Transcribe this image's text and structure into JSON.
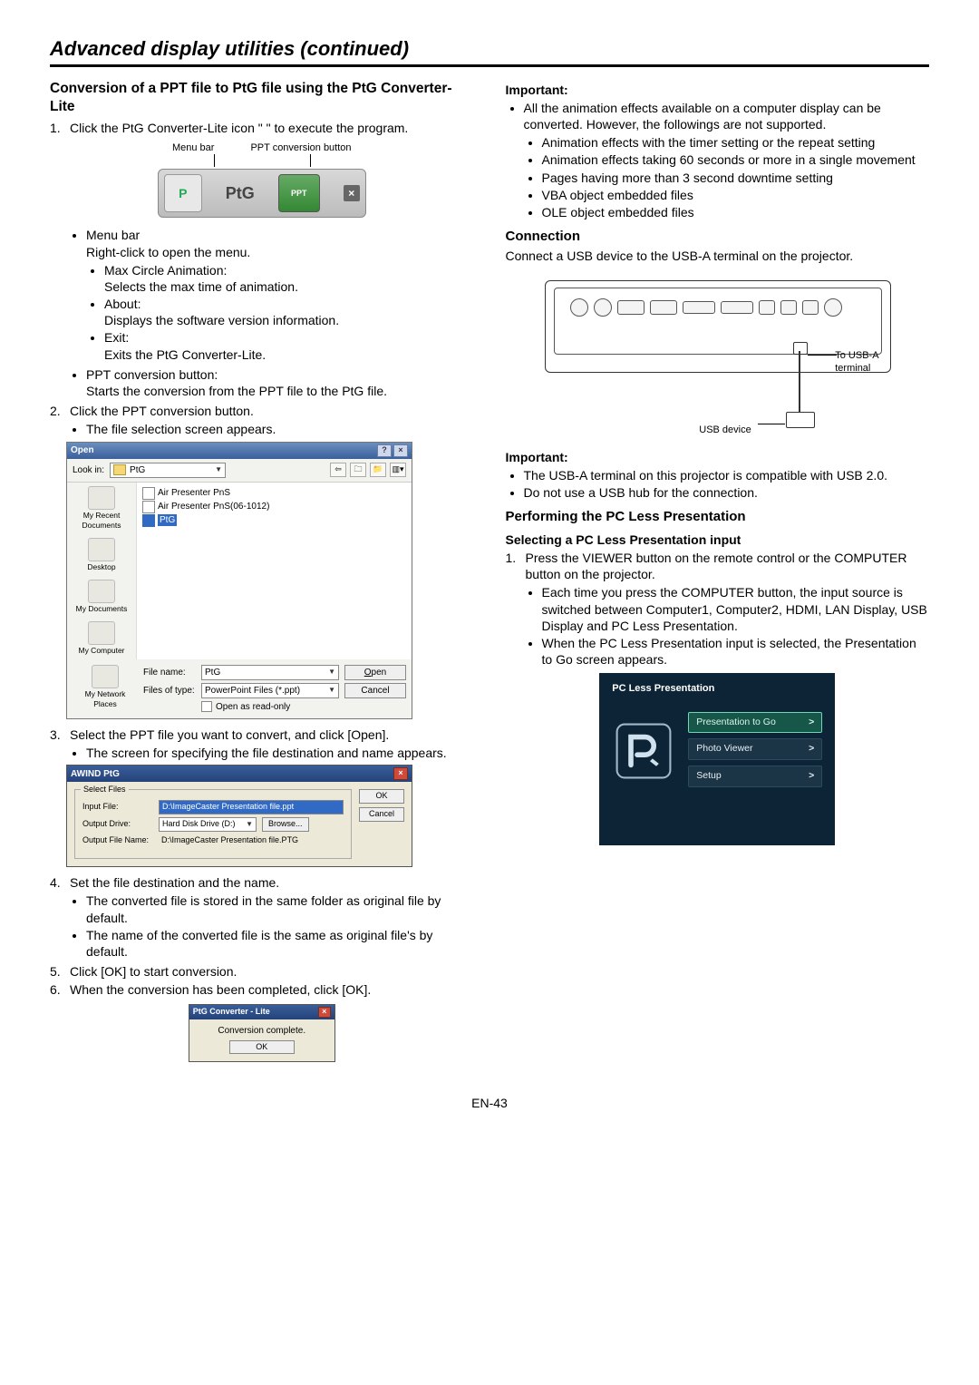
{
  "page": {
    "title": "Advanced display utilities (continued)",
    "footer": "EN-43"
  },
  "left": {
    "h2": "Conversion of a PPT file to PtG file using the PtG Converter-Lite",
    "step1": "Click the PtG Converter-Lite icon \"     \" to execute the program.",
    "labels": {
      "menubar": "Menu bar",
      "pptbtn": "PPT conversion button"
    },
    "ptg_text": "PtG",
    "ppt_btn": "PPT",
    "menu": {
      "menubar": "Menu bar",
      "menubar_sub": "Right-click to open the menu.",
      "max": "Max Circle Animation:",
      "max_sub": "Selects the max time of animation.",
      "about": "About:",
      "about_sub": "Displays the software version information.",
      "exit": "Exit:",
      "exit_sub": "Exits the PtG Converter-Lite.",
      "pptconv": "PPT conversion button:",
      "pptconv_sub": "Starts the conversion from the PPT file to the PtG file."
    },
    "step2": "Click the PPT conversion button.",
    "step2_b1": "The file selection screen appears.",
    "open": {
      "title": "Open",
      "lookin_label": "Look in:",
      "lookin_value": "PtG",
      "places": {
        "recent": "My Recent Documents",
        "desktop": "Desktop",
        "mydocs": "My Documents",
        "mycomp": "My Computer",
        "network": "My Network Places"
      },
      "files": {
        "f1": "Air Presenter PnS",
        "f2": "Air Presenter PnS(06-1012)",
        "f3": "PtG"
      },
      "filename_label": "File name:",
      "filename_value": "PtG",
      "filetype_label": "Files of type:",
      "filetype_value": "PowerPoint Files (*.ppt)",
      "readonly": "Open as read-only",
      "open_btn": "Open",
      "cancel_btn": "Cancel"
    },
    "step3": "Select the PPT file you want to convert, and click [Open].",
    "step3_b1": "The screen for specifying the file destination and name appears.",
    "awind": {
      "title": "AWIND PtG",
      "group": "Select Files",
      "input_label": "Input  File:",
      "input_value": "D:\\ImageCaster Presentation file.ppt",
      "drive_label": "Output Drive:",
      "drive_value": "Hard Disk Drive (D:)",
      "browse": "Browse...",
      "outname_label": "Output File Name:",
      "outname_value": "D:\\ImageCaster Presentation file.PTG",
      "ok": "OK",
      "cancel": "Cancel"
    },
    "step4": "Set the file destination and the name.",
    "step4_b1": "The converted file is stored in the same folder as original file by default.",
    "step4_b2": "The name of the converted file is the same as original file's by default.",
    "step5": "Click [OK] to start conversion.",
    "step6": "When the conversion has been completed, click [OK].",
    "complete": {
      "title": "PtG Converter - Lite",
      "msg": "Conversion complete.",
      "ok": "OK"
    }
  },
  "right": {
    "important_label": "Important:",
    "imp1": "All the animation effects available on a computer display can be converted. However, the followings are not supported.",
    "imp1a": "Animation effects with the timer setting or the repeat setting",
    "imp1b": "Animation effects taking 60 seconds or more  in a single movement",
    "imp1c": "Pages having more than 3 second downtime setting",
    "imp1d": "VBA object embedded files",
    "imp1e": "OLE object embedded files",
    "connection_h": "Connection",
    "connection_p": "Connect a USB device to the USB-A terminal on the projector.",
    "ann_usba": "To USB-A terminal",
    "ann_usbdev": "USB device",
    "imp2a": "The USB-A terminal on this projector is compatible with USB 2.0.",
    "imp2b": "Do not use a USB hub for the connection.",
    "perform_h": "Performing the PC Less Presentation",
    "selecting_h": "Selecting a PC Less Presentation input",
    "perf_step1": "Press the VIEWER button on the remote control or the COMPUTER button on the projector.",
    "perf_b1": "Each time you press the COMPUTER button, the input source is switched between Computer1, Computer2, HDMI, LAN Display, USB Display and PC Less Presentation.",
    "perf_b2": "When the PC Less Presentation input is selected, the Presentation to Go screen appears.",
    "pcless": {
      "title": "PC Less Presentation",
      "item1": "Presentation to Go",
      "item2": "Photo Viewer",
      "item3": "Setup"
    }
  }
}
